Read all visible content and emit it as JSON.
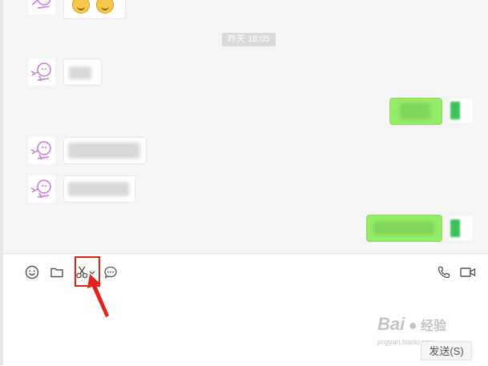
{
  "chat": {
    "timestamp": "昨天 18:05"
  },
  "toolbar": {
    "icons": [
      "emoji-icon",
      "folder-icon",
      "scissors-icon",
      "chevron-down-icon",
      "chat-bubble-icon",
      "phone-icon",
      "video-icon"
    ]
  },
  "input": {
    "send_label": "发送(S)"
  },
  "watermark": {
    "brand": "Bai",
    "brand_cn": "经验",
    "domain": "jingyan.baidu.com"
  },
  "colors": {
    "sent_bubble": "#95ec69",
    "highlight": "#e0241b",
    "chat_bg": "#f5f5f5"
  }
}
